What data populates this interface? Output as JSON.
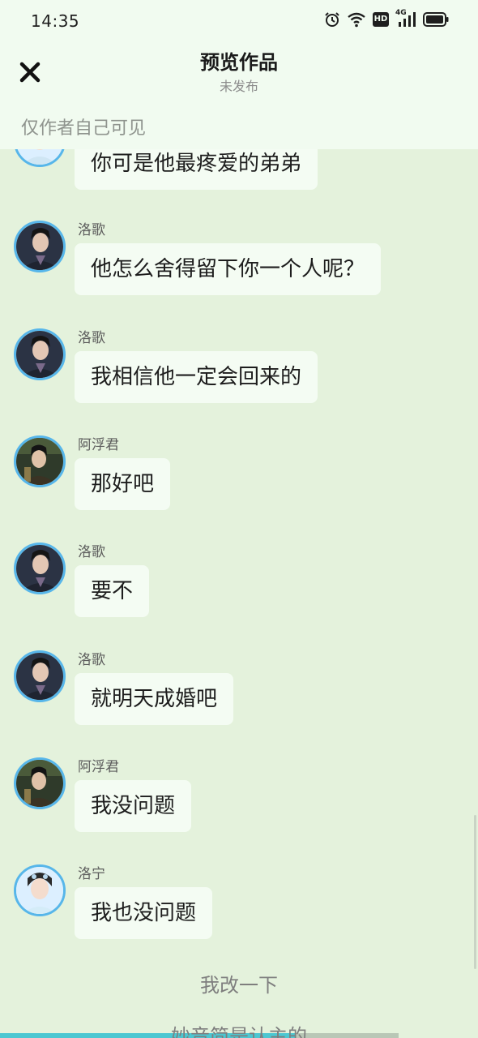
{
  "status_bar": {
    "time": "14:35",
    "icons": [
      "alarm-icon",
      "wifi-icon",
      "hd-icon",
      "signal-4g-icon",
      "battery-icon"
    ],
    "hd_text": "HD",
    "network_text": "4G"
  },
  "header": {
    "close_icon": "close-icon",
    "title": "预览作品",
    "subtitle": "未发布",
    "visibility_note": "仅作者自己可见"
  },
  "messages": [
    {
      "sender": "",
      "text": "你可是他最疼爱的弟弟",
      "avatar": "avatar-luoning"
    },
    {
      "sender": "洛歌",
      "text": "他怎么舍得留下你一个人呢？",
      "avatar": "avatar-luoge"
    },
    {
      "sender": "洛歌",
      "text": "我相信他一定会回来的",
      "avatar": "avatar-luoge"
    },
    {
      "sender": "阿浮君",
      "text": "那好吧",
      "avatar": "avatar-afujun"
    },
    {
      "sender": "洛歌",
      "text": "要不",
      "avatar": "avatar-luoge"
    },
    {
      "sender": "洛歌",
      "text": "就明天成婚吧",
      "avatar": "avatar-luoge"
    },
    {
      "sender": "阿浮君",
      "text": "我没问题",
      "avatar": "avatar-afujun"
    },
    {
      "sender": "洛宁",
      "text": "我也没问题",
      "avatar": "avatar-luoning"
    }
  ],
  "narration": [
    "我改一下",
    "妙音简是认主的"
  ],
  "playback_progress": 0.74,
  "colors": {
    "background": "#e4f2dc",
    "header": "#f1fbf0",
    "bubble": "#f4fcf3",
    "avatar_border": "#57b6ea",
    "progress": "#4cc7d1"
  }
}
